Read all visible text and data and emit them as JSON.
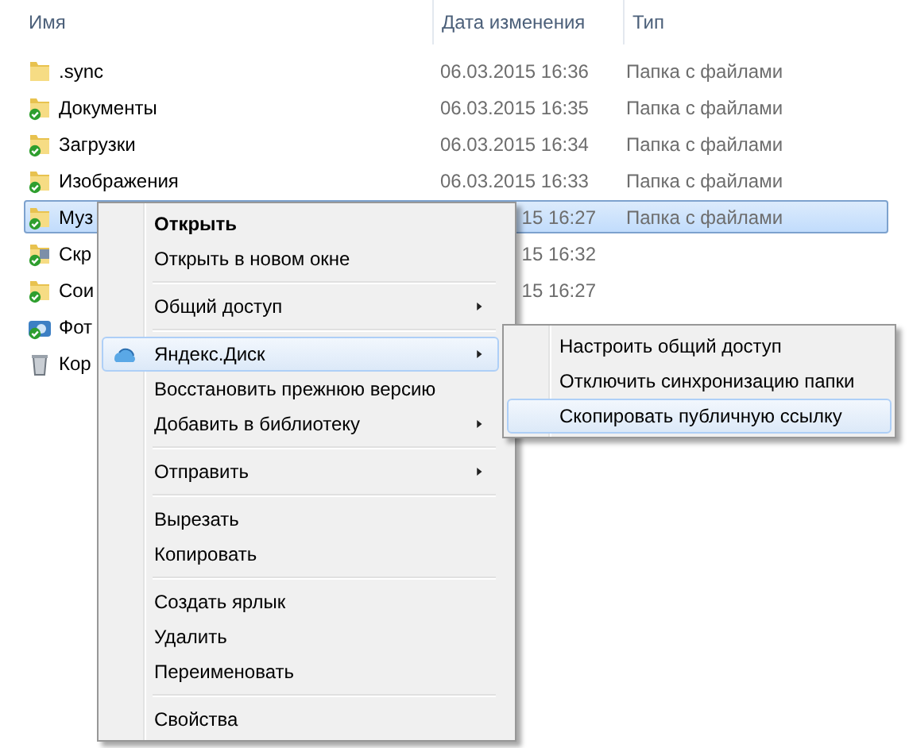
{
  "columns": [
    {
      "label": "Имя"
    },
    {
      "label": "Дата изменения"
    },
    {
      "label": "Тип"
    }
  ],
  "rows": [
    {
      "kind": "folder",
      "name": ".sync",
      "date": "06.03.2015 16:36",
      "type": "Папка с файлами",
      "selected": false,
      "covered": false
    },
    {
      "kind": "synced-folder",
      "name": "Документы",
      "date": "06.03.2015 16:35",
      "type": "Папка с файлами",
      "selected": false,
      "covered": false
    },
    {
      "kind": "synced-folder",
      "name": "Загрузки",
      "date": "06.03.2015 16:34",
      "type": "Папка с файлами",
      "selected": false,
      "covered": false
    },
    {
      "kind": "synced-folder",
      "name": "Изображения",
      "date": "06.03.2015 16:33",
      "type": "Папка с файлами",
      "selected": false,
      "covered": false
    },
    {
      "kind": "synced-folder",
      "name": "Муз",
      "date": "15 16:27",
      "type": "Папка с файлами",
      "selected": true,
      "covered": true
    },
    {
      "kind": "synced-screens",
      "name": "Скр",
      "date": "15 16:32",
      "selected": false,
      "covered": true
    },
    {
      "kind": "synced-folder",
      "name": "Сои",
      "date": "15 16:27",
      "selected": false,
      "covered": true
    },
    {
      "kind": "photos",
      "name": "Фот",
      "selected": false
    },
    {
      "kind": "recycle",
      "name": "Кор",
      "selected": false
    }
  ],
  "context_menu": [
    {
      "kind": "item",
      "label": "Открыть",
      "bold": true,
      "submenu": false,
      "selected": false
    },
    {
      "kind": "item",
      "label": "Открыть в новом окне",
      "bold": false,
      "submenu": false,
      "selected": false
    },
    {
      "kind": "separator"
    },
    {
      "kind": "item",
      "label": "Общий доступ",
      "bold": false,
      "submenu": true,
      "selected": false
    },
    {
      "kind": "separator"
    },
    {
      "kind": "cloud-item",
      "label": "Яндекс.Диск",
      "bold": false,
      "submenu": true,
      "selected": true
    },
    {
      "kind": "item",
      "label": "Восстановить прежнюю версию",
      "bold": false,
      "submenu": false,
      "selected": false
    },
    {
      "kind": "item",
      "label": "Добавить в библиотеку",
      "bold": false,
      "submenu": true,
      "selected": false
    },
    {
      "kind": "separator"
    },
    {
      "kind": "item",
      "label": "Отправить",
      "bold": false,
      "submenu": true,
      "selected": false
    },
    {
      "kind": "separator"
    },
    {
      "kind": "item",
      "label": "Вырезать",
      "bold": false,
      "submenu": false,
      "selected": false
    },
    {
      "kind": "item",
      "label": "Копировать",
      "bold": false,
      "submenu": false,
      "selected": false
    },
    {
      "kind": "separator"
    },
    {
      "kind": "item",
      "label": "Создать ярлык",
      "bold": false,
      "submenu": false,
      "selected": false
    },
    {
      "kind": "item",
      "label": "Удалить",
      "bold": false,
      "submenu": false,
      "selected": false
    },
    {
      "kind": "item",
      "label": "Переименовать",
      "bold": false,
      "submenu": false,
      "selected": false
    },
    {
      "kind": "separator"
    },
    {
      "kind": "item",
      "label": "Свойства",
      "bold": false,
      "submenu": false,
      "selected": false
    }
  ],
  "submenu": [
    {
      "label": "Настроить общий доступ",
      "selected": false
    },
    {
      "label": "Отключить синхронизацию папки",
      "selected": false
    },
    {
      "label": "Скопировать публичную ссылку",
      "selected": true
    }
  ]
}
